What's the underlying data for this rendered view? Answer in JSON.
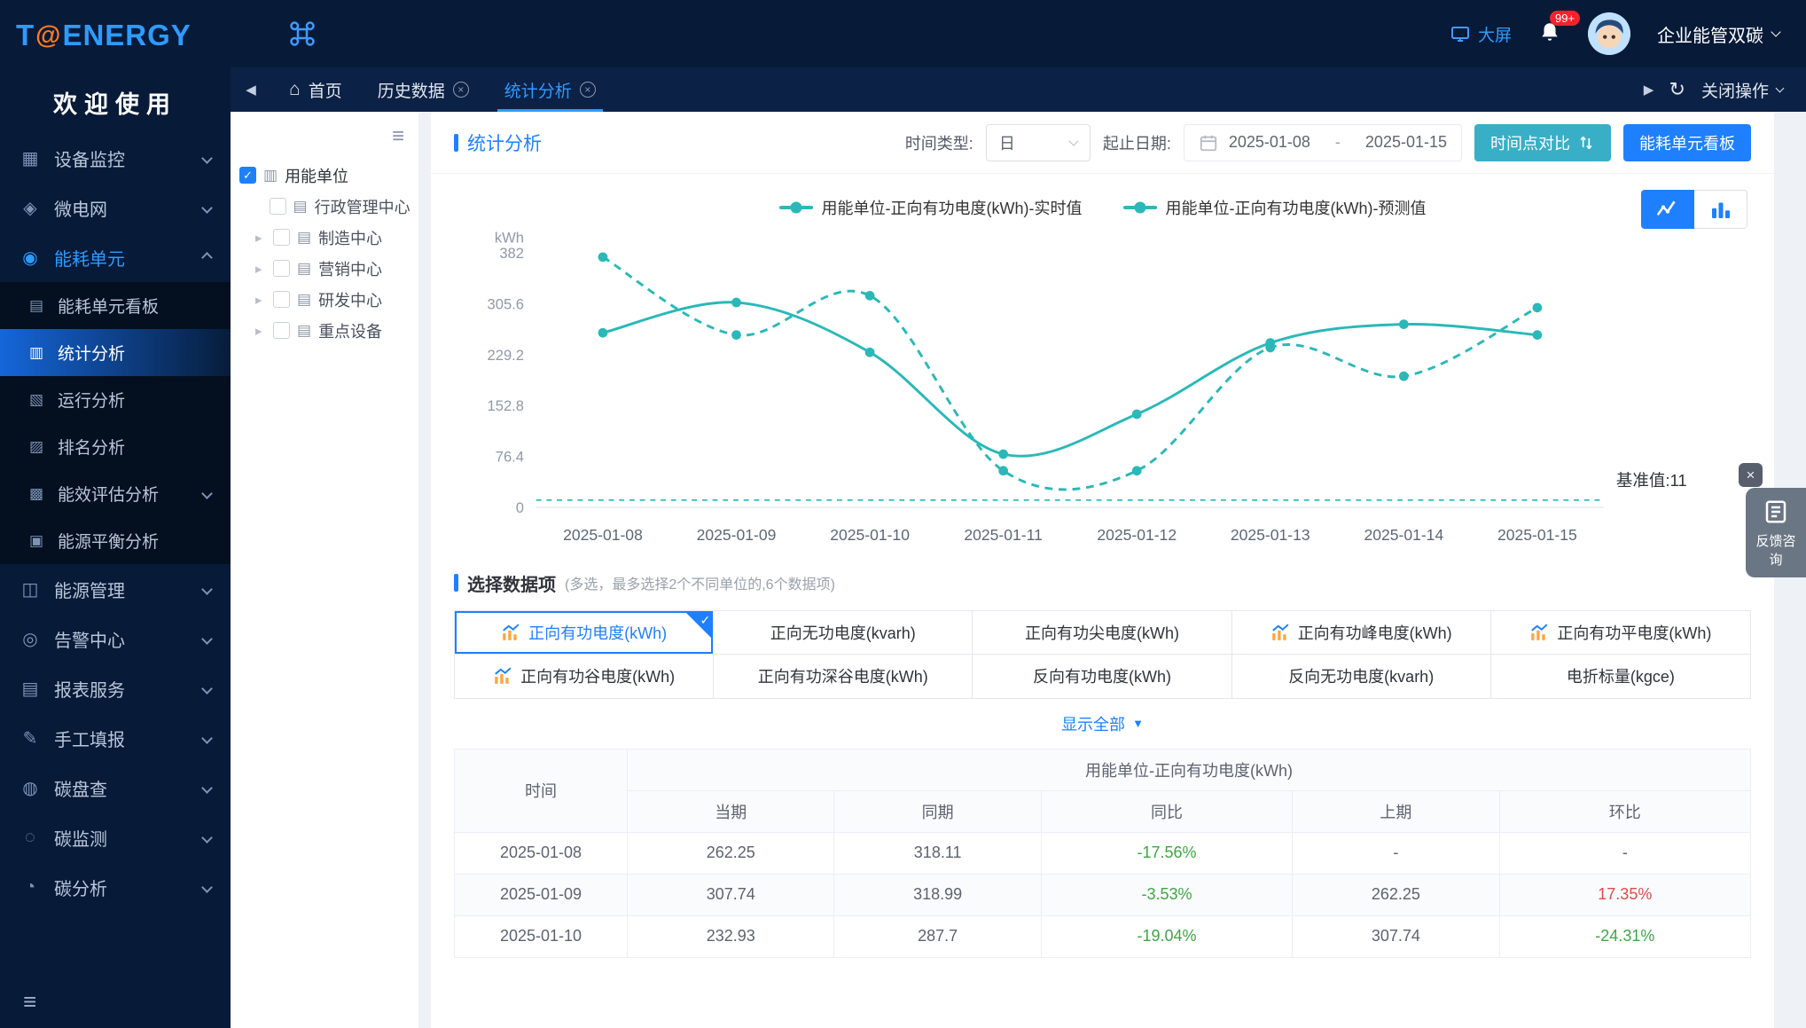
{
  "app": {
    "logo": {
      "t": "T",
      "at": "@",
      "rest": "ENERGY"
    },
    "welcome": "欢迎使用",
    "topbar": {
      "big_screen": "大屏",
      "notif_badge": "99+",
      "account": "企业能管双碳"
    }
  },
  "icons": {
    "home": "⌂",
    "close_tab": "×",
    "back_arrow": "◀",
    "forward_arrow": "▶",
    "refresh": "↻",
    "hamburger": "≡",
    "caret_right": "▸",
    "check": "✓",
    "triangle_down": "▼",
    "close": "×"
  },
  "sidebar": {
    "items": [
      {
        "label": "设备监控",
        "icon": "device-monitor-icon",
        "expandable": true
      },
      {
        "label": "微电网",
        "icon": "microgrid-icon",
        "expandable": true
      },
      {
        "label": "能耗单元",
        "icon": "energy-unit-icon",
        "expandable": true,
        "expanded": true,
        "active": true,
        "children": [
          {
            "label": "能耗单元看板",
            "icon": "dashboard-icon"
          },
          {
            "label": "统计分析",
            "icon": "stats-icon",
            "active": true
          },
          {
            "label": "运行分析",
            "icon": "run-analysis-icon"
          },
          {
            "label": "排名分析",
            "icon": "rank-analysis-icon"
          },
          {
            "label": "能效评估分析",
            "icon": "efficiency-analysis-icon",
            "expandable": true
          },
          {
            "label": "能源平衡分析",
            "icon": "energy-balance-icon"
          }
        ]
      },
      {
        "label": "能源管理",
        "icon": "energy-mgmt-icon",
        "expandable": true
      },
      {
        "label": "告警中心",
        "icon": "alarm-icon",
        "expandable": true
      },
      {
        "label": "报表服务",
        "icon": "report-icon",
        "expandable": true
      },
      {
        "label": "手工填报",
        "icon": "manual-report-icon",
        "expandable": true
      },
      {
        "label": "碳盘查",
        "icon": "carbon-check-icon",
        "expandable": true
      },
      {
        "label": "碳监测",
        "icon": "carbon-monitor-icon",
        "expandable": true
      },
      {
        "label": "碳分析",
        "icon": "carbon-analysis-icon",
        "expandable": true
      }
    ]
  },
  "tabs": [
    {
      "label": "首页",
      "home": true
    },
    {
      "label": "历史数据",
      "closable": true
    },
    {
      "label": "统计分析",
      "closable": true,
      "active": true
    }
  ],
  "tabbar": {
    "close_ops": "关闭操作"
  },
  "tree": {
    "root": {
      "label": "用能单位",
      "checked": true
    },
    "children": [
      {
        "label": "行政管理中心",
        "caret": false
      },
      {
        "label": "制造中心",
        "caret": true
      },
      {
        "label": "营销中心",
        "caret": true
      },
      {
        "label": "研发中心",
        "caret": true
      },
      {
        "label": "重点设备",
        "caret": true
      }
    ]
  },
  "toolbar": {
    "title": "统计分析",
    "time_type_label": "时间类型:",
    "time_type_value": "日",
    "date_range_label": "起止日期:",
    "date_start": "2025-01-08",
    "date_sep": "-",
    "date_end": "2025-01-15",
    "compare_button": "时间点对比",
    "board_button": "能耗单元看板"
  },
  "chart_data": {
    "type": "line",
    "ylabel": "kWh",
    "x": [
      "2025-01-08",
      "2025-01-09",
      "2025-01-10",
      "2025-01-11",
      "2025-01-12",
      "2025-01-13",
      "2025-01-14",
      "2025-01-15"
    ],
    "yticks": [
      0,
      76.4,
      152.8,
      229.2,
      305.6,
      382
    ],
    "ylim": [
      0,
      382
    ],
    "grid": false,
    "legend_position": "top",
    "series": [
      {
        "name": "用能单位-正向有功电度(kWh)-实时值",
        "style": "solid",
        "color": "#2ab8b8",
        "values": [
          262.25,
          307.74,
          232.93,
          80,
          140,
          247,
          275,
          259
        ]
      },
      {
        "name": "用能单位-正向有功电度(kWh)-预测值",
        "style": "dashed",
        "color": "#2ab8b8",
        "values": [
          376,
          259,
          318,
          55,
          55,
          240,
          197,
          300
        ]
      }
    ],
    "baseline": {
      "label": "基准值:11",
      "value": 11
    }
  },
  "data_select": {
    "title": "选择数据项",
    "note": "(多选，最多选择2个不同单位的,6个数据项)",
    "show_all": "显示全部",
    "items": [
      {
        "label": "正向有功电度(kWh)",
        "selected": true,
        "icon": true
      },
      {
        "label": "正向无功电度(kvarh)"
      },
      {
        "label": "正向有功尖电度(kWh)"
      },
      {
        "label": "正向有功峰电度(kWh)",
        "icon": true
      },
      {
        "label": "正向有功平电度(kWh)",
        "icon": true
      },
      {
        "label": "正向有功谷电度(kWh)",
        "icon": true
      },
      {
        "label": "正向有功深谷电度(kWh)"
      },
      {
        "label": "反向有功电度(kWh)"
      },
      {
        "label": "反向无功电度(kvarh)"
      },
      {
        "label": "电折标量(kgce)"
      }
    ]
  },
  "table": {
    "time_header": "时间",
    "group_header": "用能单位-正向有功电度(kWh)",
    "sub_headers": [
      "当期",
      "同期",
      "同比",
      "上期",
      "环比"
    ],
    "rows": [
      {
        "time": "2025-01-08",
        "cells": [
          {
            "v": "262.25"
          },
          {
            "v": "318.11"
          },
          {
            "v": "-17.56%",
            "c": "green"
          },
          {
            "v": "-"
          },
          {
            "v": "-"
          }
        ]
      },
      {
        "time": "2025-01-09",
        "cells": [
          {
            "v": "307.74"
          },
          {
            "v": "318.99"
          },
          {
            "v": "-3.53%",
            "c": "green"
          },
          {
            "v": "262.25"
          },
          {
            "v": "17.35%",
            "c": "red"
          }
        ]
      },
      {
        "time": "2025-01-10",
        "cells": [
          {
            "v": "232.93"
          },
          {
            "v": "287.7"
          },
          {
            "v": "-19.04%",
            "c": "green"
          },
          {
            "v": "307.74"
          },
          {
            "v": "-24.31%",
            "c": "green"
          }
        ]
      }
    ]
  },
  "feedback": {
    "label": "反馈咨询"
  },
  "colors": {
    "accent": "#1e80ff",
    "teal": "#2ab8b8",
    "button_teal": "#38afc7",
    "green": "#3da742",
    "red": "#e04b4b",
    "badge_red": "#f5222d"
  }
}
